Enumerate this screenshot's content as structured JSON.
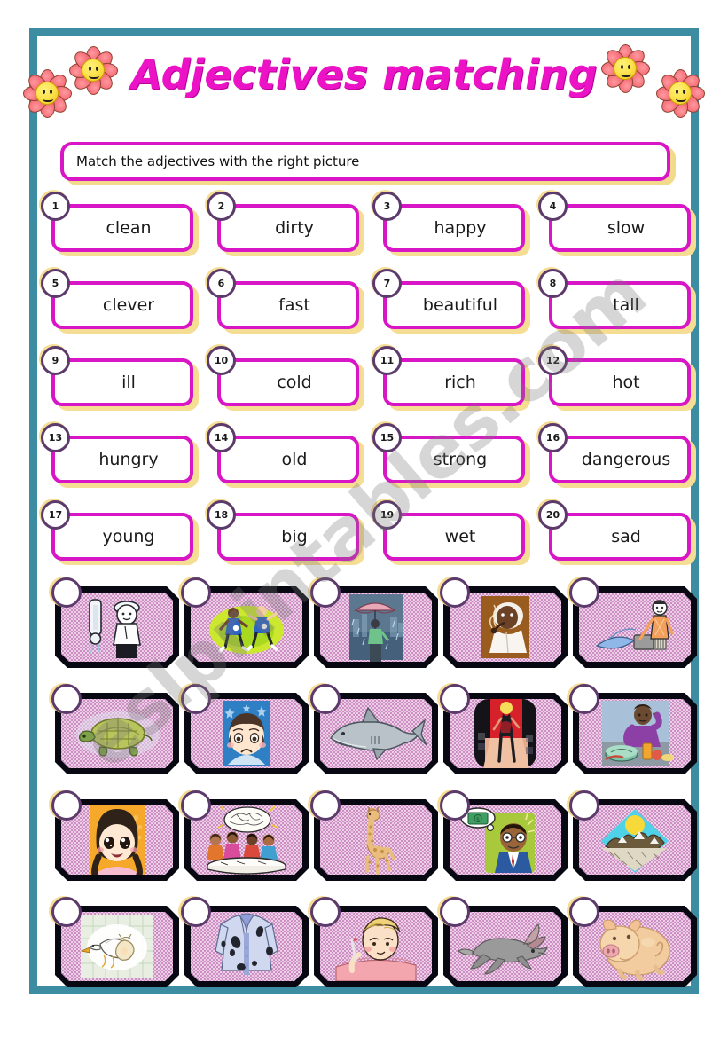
{
  "page": {
    "title": "Adjectives matching",
    "border_color": "#3c8ca2",
    "accent_color": "#d916c5",
    "title_color": "#ec13c6",
    "circle_color": "#5c3a6b",
    "shadow_color": "#f5dd93",
    "card_bg_color": "#eccfe6",
    "watermark": "eslprintables.com"
  },
  "instruction": {
    "text": "Match the adjectives with the right picture"
  },
  "words": [
    {
      "number": "1",
      "label": "clean"
    },
    {
      "number": "2",
      "label": "dirty"
    },
    {
      "number": "3",
      "label": "happy"
    },
    {
      "number": "4",
      "label": "slow"
    },
    {
      "number": "5",
      "label": "clever"
    },
    {
      "number": "6",
      "label": "fast"
    },
    {
      "number": "7",
      "label": "beautiful"
    },
    {
      "number": "8",
      "label": "tall"
    },
    {
      "number": "9",
      "label": "ill"
    },
    {
      "number": "10",
      "label": "cold"
    },
    {
      "number": "11",
      "label": "rich"
    },
    {
      "number": "12",
      "label": "hot"
    },
    {
      "number": "13",
      "label": "hungry"
    },
    {
      "number": "14",
      "label": "old"
    },
    {
      "number": "15",
      "label": "strong"
    },
    {
      "number": "16",
      "label": "dangerous"
    },
    {
      "number": "17",
      "label": "young"
    },
    {
      "number": "18",
      "label": "big"
    },
    {
      "number": "19",
      "label": "wet"
    },
    {
      "number": "20",
      "label": "sad"
    }
  ],
  "cards": [
    {
      "id": "card-1",
      "picture": "cold-man-thermometer-icon",
      "answer": ""
    },
    {
      "id": "card-2",
      "picture": "runners-racing-icon",
      "answer": ""
    },
    {
      "id": "card-3",
      "picture": "person-umbrella-rain-icon",
      "answer": ""
    },
    {
      "id": "card-4",
      "picture": "man-smoking-pipe-icon",
      "answer": ""
    },
    {
      "id": "card-5",
      "picture": "child-cleaning-icon",
      "answer": ""
    },
    {
      "id": "card-6",
      "picture": "tortoise-icon",
      "answer": ""
    },
    {
      "id": "card-7",
      "picture": "sad-child-face-icon",
      "answer": ""
    },
    {
      "id": "card-8",
      "picture": "shark-icon",
      "answer": ""
    },
    {
      "id": "card-9",
      "picture": "fashion-model-runway-icon",
      "answer": ""
    },
    {
      "id": "card-10",
      "picture": "hungry-man-at-table-icon",
      "answer": ""
    },
    {
      "id": "card-11",
      "picture": "happy-girl-face-icon",
      "answer": ""
    },
    {
      "id": "card-12",
      "picture": "brainstorm-meeting-icon",
      "answer": ""
    },
    {
      "id": "card-13",
      "picture": "giraffe-icon",
      "answer": ""
    },
    {
      "id": "card-14",
      "picture": "rich-man-money-thought-icon",
      "answer": ""
    },
    {
      "id": "card-15",
      "picture": "mountain-sun-icon",
      "answer": ""
    },
    {
      "id": "card-16",
      "picture": "stork-carrying-baby-icon",
      "answer": ""
    },
    {
      "id": "card-17",
      "picture": "dirty-stained-jacket-icon",
      "answer": ""
    },
    {
      "id": "card-18",
      "picture": "sick-person-in-bed-icon",
      "answer": ""
    },
    {
      "id": "card-19",
      "picture": "running-hare-icon",
      "answer": ""
    },
    {
      "id": "card-20",
      "picture": "fat-pig-icon",
      "answer": ""
    }
  ]
}
